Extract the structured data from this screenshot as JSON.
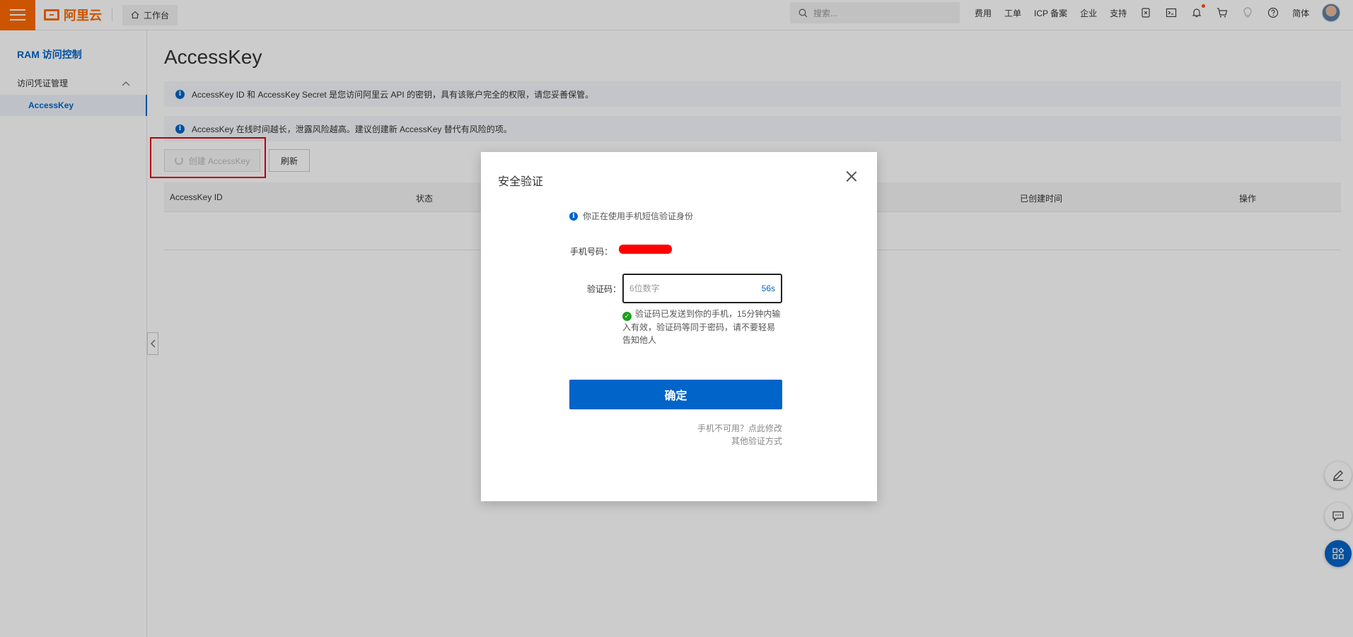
{
  "topbar": {
    "logo_text": "阿里云",
    "workbench": "工作台",
    "search_placeholder": "搜索...",
    "nav": [
      "费用",
      "工单",
      "ICP 备案",
      "企业",
      "支持"
    ],
    "language": "简体"
  },
  "sidebar": {
    "title": "RAM 访问控制",
    "group": "访问凭证管理",
    "active_item": "AccessKey"
  },
  "main": {
    "page_title": "AccessKey",
    "notice1": "AccessKey ID 和 AccessKey Secret 是您访问阿里云 API 的密钥，具有该账户完全的权限，请您妥善保管。",
    "notice2": "AccessKey 在线时间越长，泄露风险越高。建议创建新 AccessKey 替代有风险的项。",
    "create_button": "创建 AccessKey",
    "refresh_button": "刷新",
    "columns": [
      "AccessKey ID",
      "状态",
      "已创建时间",
      "操作"
    ]
  },
  "modal": {
    "title": "安全验证",
    "hint": "你正在使用手机短信验证身份",
    "phone_label": "手机号码：",
    "code_label": "验证码：",
    "code_placeholder": "6位数字",
    "countdown": "56s",
    "sent_message": "验证码已发送到你的手机，15分钟内输入有效，验证码等同于密码，请不要轻易告知他人",
    "confirm_button": "确定",
    "phone_unavailable": "手机不可用？点此修改",
    "other_methods": "其他验证方式"
  },
  "colors": {
    "brand": "#ff6a00",
    "primary": "#0064c8",
    "highlight": "#e60012",
    "success": "#1ba21b"
  }
}
